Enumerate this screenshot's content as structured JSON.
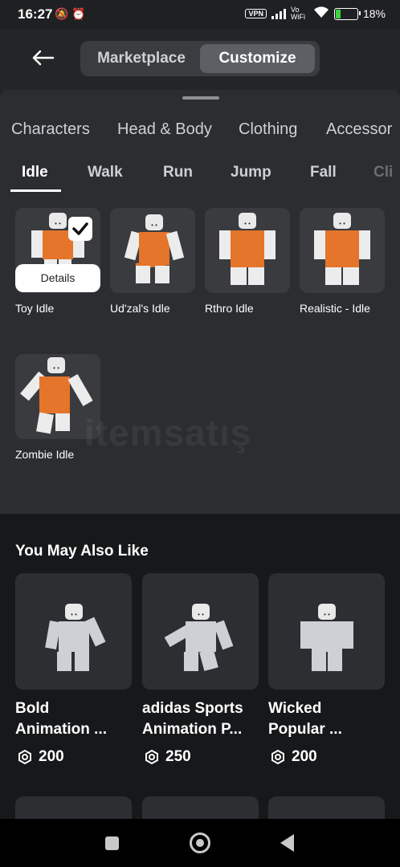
{
  "status_bar": {
    "time": "16:27",
    "vpn_label": "VPN",
    "wifi_label": "Vo WiFi",
    "battery_percent": "18%",
    "left_icons": [
      "bell-off-icon",
      "alarm-icon"
    ]
  },
  "header": {
    "back_icon": "arrow-left-icon",
    "tabs": [
      "Marketplace",
      "Customize"
    ],
    "active_tab": "Customize"
  },
  "categories": [
    "Characters",
    "Head & Body",
    "Clothing",
    "Accessor"
  ],
  "animation_tabs": [
    "Idle",
    "Walk",
    "Run",
    "Jump",
    "Fall",
    "Cli"
  ],
  "active_animation_tab": "Idle",
  "items": [
    {
      "name": "Toy Idle",
      "selected": true,
      "details_label": "Details"
    },
    {
      "name": "Ud'zal's Idle"
    },
    {
      "name": "Rthro Idle"
    },
    {
      "name": "Realistic - Idle"
    },
    {
      "name": "Zombie Idle"
    }
  ],
  "watermark": "itemsatış",
  "you_may_also_like": {
    "title": "You May Also Like",
    "cards": [
      {
        "line1": "Bold",
        "line2": "Animation ...",
        "price": "200"
      },
      {
        "line1": "adidas Sports",
        "line2": "Animation P...",
        "price": "250"
      },
      {
        "line1": "Wicked",
        "line2": "Popular ...",
        "price": "200"
      }
    ]
  },
  "colors": {
    "background": "#232527",
    "sheet": "#2b2d30",
    "tile": "#393b3e",
    "lower": "#17181a",
    "torso_orange": "#e4752a"
  },
  "nav_bar": [
    "square-recent-icon",
    "circle-home-icon",
    "triangle-back-icon"
  ]
}
